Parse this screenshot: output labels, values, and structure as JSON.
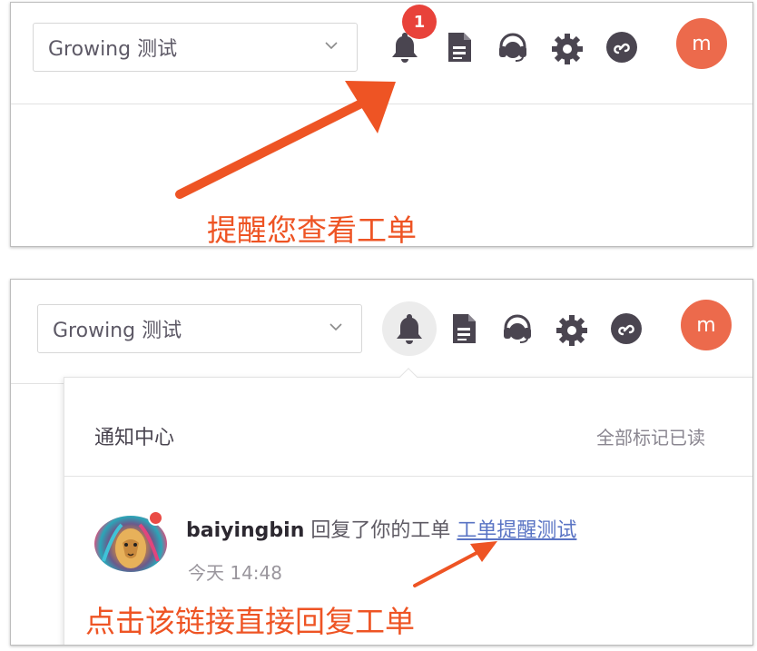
{
  "header": {
    "project_select": "Growing 测试",
    "notification_count": "1",
    "avatar_initial": "m"
  },
  "annotations": {
    "top": "提醒您查看工单",
    "bottom": "点击该链接直接回复工单"
  },
  "notification_center": {
    "title": "通知中心",
    "mark_all_read": "全部标记已读",
    "items": [
      {
        "user": "baiyingbin",
        "action": "回复了你的工单",
        "ticket_link": "工单提醒测试",
        "time": "今天 14:48"
      }
    ]
  },
  "colors": {
    "accent_orange": "#ee5424",
    "badge_red": "#e8423a",
    "avatar_bg": "#ec6a4c",
    "icon_dark": "#4a4550",
    "link_blue": "#5a74c4"
  }
}
